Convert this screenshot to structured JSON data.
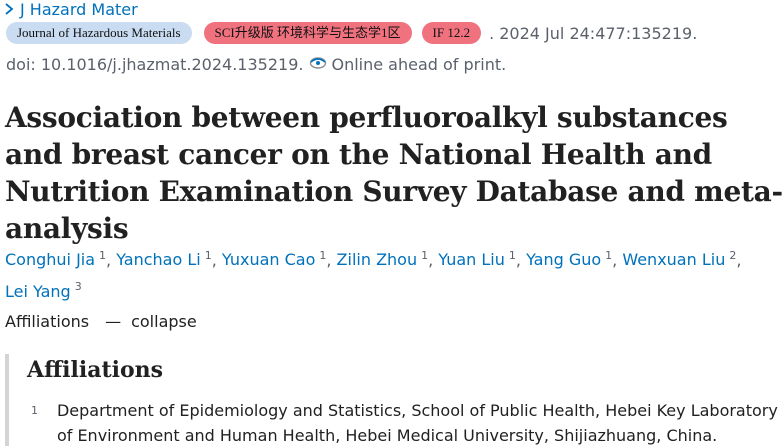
{
  "journal": {
    "link_text": "J Hazard Mater"
  },
  "badges": {
    "journal_name": "Journal of Hazardous Materials",
    "sci_zone": "SCI升级版 环境科学与生态学1区",
    "impact_factor": "IF 12.2"
  },
  "citation": ". 2024 Jul 24:477:135219.",
  "doi": {
    "text": "doi: 10.1016/j.jhazmat.2024.135219.",
    "online_status": "Online ahead of print."
  },
  "title": "Association between perfluoroalkyl substances and breast cancer on the National Health and Nutrition Examination Survey Database and meta-analysis",
  "authors": [
    {
      "name": "Conghui Jia",
      "sup": "1"
    },
    {
      "name": "Yanchao Li",
      "sup": "1"
    },
    {
      "name": "Yuxuan Cao",
      "sup": "1"
    },
    {
      "name": "Zilin Zhou",
      "sup": "1"
    },
    {
      "name": "Yuan Liu",
      "sup": "1"
    },
    {
      "name": "Yang Guo",
      "sup": "1"
    },
    {
      "name": "Wenxuan Liu",
      "sup": "2"
    },
    {
      "name": "Lei Yang",
      "sup": "3"
    }
  ],
  "affiliations_toggle": {
    "label": "Affiliations",
    "dash": "—",
    "action": "collapse"
  },
  "affiliations": {
    "heading": "Affiliations",
    "items": [
      {
        "num": "1",
        "text": "Department of Epidemiology and Statistics, School of Public Health, Hebei Key Laboratory of Environment and Human Health, Hebei Medical University, Shijiazhuang, China."
      }
    ]
  },
  "colors": {
    "link": "#0071bc",
    "badge_journal": "#c9dcf2",
    "badge_zone": "#f0727f",
    "muted": "#5b616b"
  }
}
